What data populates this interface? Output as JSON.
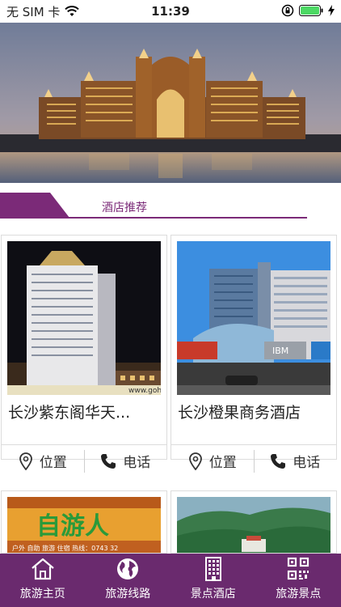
{
  "status_bar": {
    "carrier": "无 SIM 卡",
    "time": "11:39"
  },
  "section": {
    "title": "酒店推荐"
  },
  "hotels": [
    {
      "name": "长沙紫东阁华天...",
      "location_label": "位置",
      "phone_label": "电话"
    },
    {
      "name": "长沙橙果商务酒店",
      "location_label": "位置",
      "phone_label": "电话"
    }
  ],
  "photo_captions": {
    "hotel1_watermark": "www.gohua",
    "hotel3_sign": "自游人",
    "hotel3_sign_sub": "户外 自助 旅游 住宿 热线：0743 32",
    "hotel2_logo": "IBM"
  },
  "tabbar": {
    "items": [
      {
        "label": "旅游主页",
        "icon": "home-icon"
      },
      {
        "label": "旅游线路",
        "icon": "globe-icon"
      },
      {
        "label": "景点酒店",
        "icon": "building-icon"
      },
      {
        "label": "旅游景点",
        "icon": "qr-code-icon"
      }
    ]
  },
  "colors": {
    "accent": "#7b2a78",
    "tabbar_bg": "#6a2a6e",
    "battery": "#4cd964"
  }
}
